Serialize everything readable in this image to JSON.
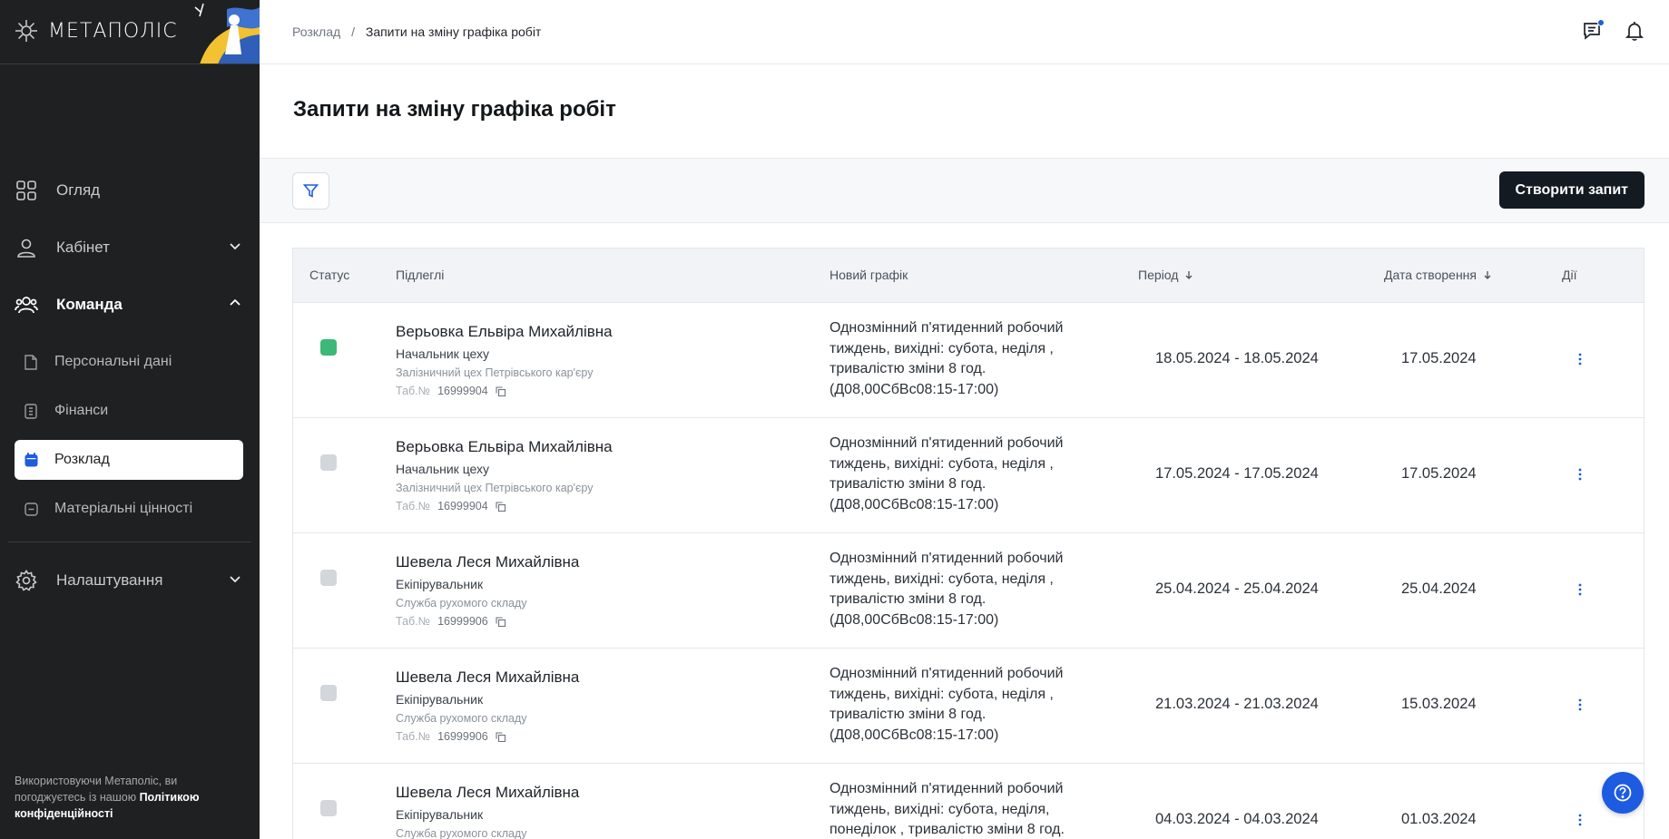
{
  "app": {
    "logo_text": "МЕТАПОЛІС"
  },
  "breadcrumb": {
    "parent": "Розклад",
    "separator": "/",
    "current": "Запити на зміну графіка робіт"
  },
  "page": {
    "title": "Запити на зміну графіка робіт"
  },
  "toolbar": {
    "create_label": "Створити запит"
  },
  "sidebar": {
    "items": [
      {
        "label": "Огляд",
        "icon": "grid-icon"
      },
      {
        "label": "Кабінет",
        "icon": "user-icon"
      },
      {
        "label": "Команда",
        "icon": "team-icon"
      }
    ],
    "subitems": [
      {
        "label": "Персональні дані",
        "icon": "document-icon"
      },
      {
        "label": "Фінанси",
        "icon": "finance-icon"
      },
      {
        "label": "Розклад",
        "icon": "calendar-icon"
      },
      {
        "label": "Матеріальні цінності",
        "icon": "assets-icon"
      }
    ],
    "settings": {
      "label": "Налаштування",
      "icon": "gear-icon"
    },
    "footer": {
      "text": "Використовуючи Метаполіс, ви погоджуєтесь із нашою",
      "link": "Політикою конфіденційності"
    }
  },
  "table": {
    "headers": {
      "status": "Статус",
      "employee": "Підлеглі",
      "schedule": "Новий графік",
      "period": "Період",
      "created": "Дата створення",
      "actions": "Дії"
    },
    "tab_label": "Таб.№",
    "rows": [
      {
        "status": "green",
        "name": "Верьовка Ельвіра Михайлівна",
        "position": "Начальник цеху",
        "department": "Залізничний цех Петрівського кар'єру",
        "tab": "16999904",
        "schedule": "Однозмінний п'ятиденний робочий тиждень, вихідні: субота, неділя , тривалістю зміни 8 год. (Д08,00СбВс08:15-17:00)",
        "period": "18.05.2024 - 18.05.2024",
        "created": "17.05.2024"
      },
      {
        "status": "gray",
        "name": "Верьовка Ельвіра Михайлівна",
        "position": "Начальник цеху",
        "department": "Залізничний цех Петрівського кар'єру",
        "tab": "16999904",
        "schedule": "Однозмінний п'ятиденний робочий тиждень, вихідні: субота, неділя , тривалістю зміни 8 год. (Д08,00СбВс08:15-17:00)",
        "period": "17.05.2024 - 17.05.2024",
        "created": "17.05.2024"
      },
      {
        "status": "gray",
        "name": "Шевела Леся Михайлівна",
        "position": "Екіпірувальник",
        "department": "Служба рухомого складу",
        "tab": "16999906",
        "schedule": "Однозмінний п'ятиденний робочий тиждень, вихідні: субота, неділя , тривалістю зміни 8 год. (Д08,00СбВс08:15-17:00)",
        "period": "25.04.2024 - 25.04.2024",
        "created": "25.04.2024"
      },
      {
        "status": "gray",
        "name": "Шевела Леся Михайлівна",
        "position": "Екіпірувальник",
        "department": "Служба рухомого складу",
        "tab": "16999906",
        "schedule": "Однозмінний п'ятиденний робочий тиждень, вихідні: субота, неділя , тривалістю зміни 8 год. (Д08,00СбВс08:15-17:00)",
        "period": "21.03.2024 - 21.03.2024",
        "created": "15.03.2024"
      },
      {
        "status": "gray",
        "name": "Шевела Леся Михайлівна",
        "position": "Екіпірувальник",
        "department": "Служба рухомого складу",
        "tab": "",
        "schedule": "Однозмінний п'ятиденний робочий тиждень, вихідні: субота, неділя, понеділок , тривалістю зміни 8 год.",
        "period": "04.03.2024 - 04.03.2024",
        "created": "01.03.2024"
      }
    ]
  },
  "colors": {
    "accent": "#1d5be0",
    "status_active": "#3cb877",
    "status_inactive": "#d3d6da",
    "sidebar_bg": "#1f2021"
  }
}
